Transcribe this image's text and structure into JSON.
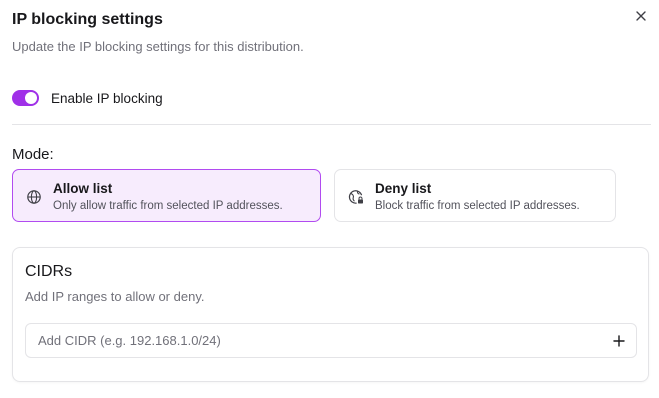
{
  "dialog": {
    "title": "IP blocking settings",
    "subtitle": "Update the IP blocking settings for this distribution."
  },
  "toggle": {
    "label": "Enable IP blocking",
    "enabled": true,
    "color": "#a030e8"
  },
  "mode": {
    "label": "Mode:",
    "options": [
      {
        "title": "Allow list",
        "description": "Only allow traffic from selected IP addresses.",
        "icon": "globe-icon",
        "selected": true
      },
      {
        "title": "Deny list",
        "description": "Block traffic from selected IP addresses.",
        "icon": "globe-lock-icon",
        "selected": false
      }
    ]
  },
  "cidrs": {
    "title": "CIDRs",
    "description": "Add IP ranges to allow or deny.",
    "input_placeholder": "Add CIDR (e.g. 192.168.1.0/24)",
    "input_value": ""
  },
  "colors": {
    "accent": "#a030e8",
    "selected_border": "#b14bf0",
    "selected_bg": "#f7ecfd"
  }
}
